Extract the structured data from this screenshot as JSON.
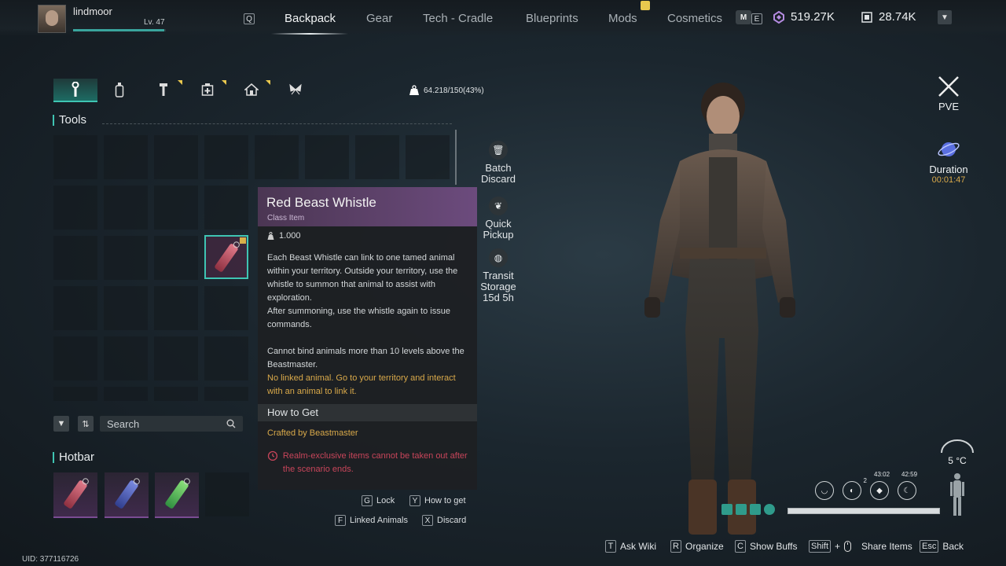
{
  "player": {
    "name": "lindmoor",
    "level": "Lv. 47",
    "xp_fraction": 0.98
  },
  "nav": {
    "left_key": "Q",
    "right_key": "E",
    "tabs": [
      "Backpack",
      "Gear",
      "Tech - Cradle",
      "Blueprints",
      "Mods",
      "Cosmetics"
    ],
    "active_tab": "Backpack"
  },
  "currency": {
    "primary": "519.27K",
    "secondary": "28.74K"
  },
  "categories": [
    "wrench-icon",
    "bottle-icon",
    "hammer-icon",
    "medkit-icon",
    "house-icon",
    "butterfly-icon"
  ],
  "capacity": "64.218/150(43%)",
  "section_title": "Tools",
  "search": {
    "label": "Search"
  },
  "hotbar_title": "Hotbar",
  "uid": "UID: 377116726",
  "tooltip": {
    "name": "Red Beast Whistle",
    "type": "Class Item",
    "weight": "1.000",
    "desc1": "Each Beast Whistle can link to one tamed animal within your territory. Outside your territory, use the whistle to summon that animal to assist with exploration.",
    "desc2": "After summoning, use the whistle again to issue commands.",
    "desc3": "Cannot bind animals more than 10 levels above the Beastmaster.",
    "warning": "No linked animal. Go to your territory and interact with an animal to link it.",
    "how_to_get": "How to Get",
    "crafted": "Crafted by Beastmaster",
    "realm_note": "Realm-exclusive items cannot be taken out after the scenario ends.",
    "keys": [
      {
        "key": "G",
        "label": "Lock"
      },
      {
        "key": "Y",
        "label": "How to get"
      },
      {
        "key": "F",
        "label": "Linked Animals"
      },
      {
        "key": "X",
        "label": "Discard"
      }
    ]
  },
  "side_actions": {
    "batch_discard": "Batch\nDiscard",
    "quick_pickup": "Quick\nPickup",
    "transit_storage": "Transit\nStorage",
    "transit_time": "15d 5h"
  },
  "mode": {
    "label": "PVE"
  },
  "duration": {
    "label": "Duration",
    "time": "00:01:47"
  },
  "temperature": "5 °C",
  "buffs": {
    "b2_count": "2",
    "b3_timer": "43:02",
    "b4_timer": "42:59"
  },
  "bottom_keys": [
    {
      "key": "T",
      "label": "Ask Wiki"
    },
    {
      "key": "R",
      "label": "Organize"
    },
    {
      "key": "C",
      "label": "Show Buffs"
    },
    {
      "key": "Shift",
      "plus": "+",
      "label": "Share Items"
    },
    {
      "key": "Esc",
      "label": "Back"
    }
  ],
  "colors": {
    "accent": "#3fc5b3",
    "gold": "#d9a94a",
    "rarity_purple": "#6c4b7d",
    "danger": "#c8455a"
  }
}
